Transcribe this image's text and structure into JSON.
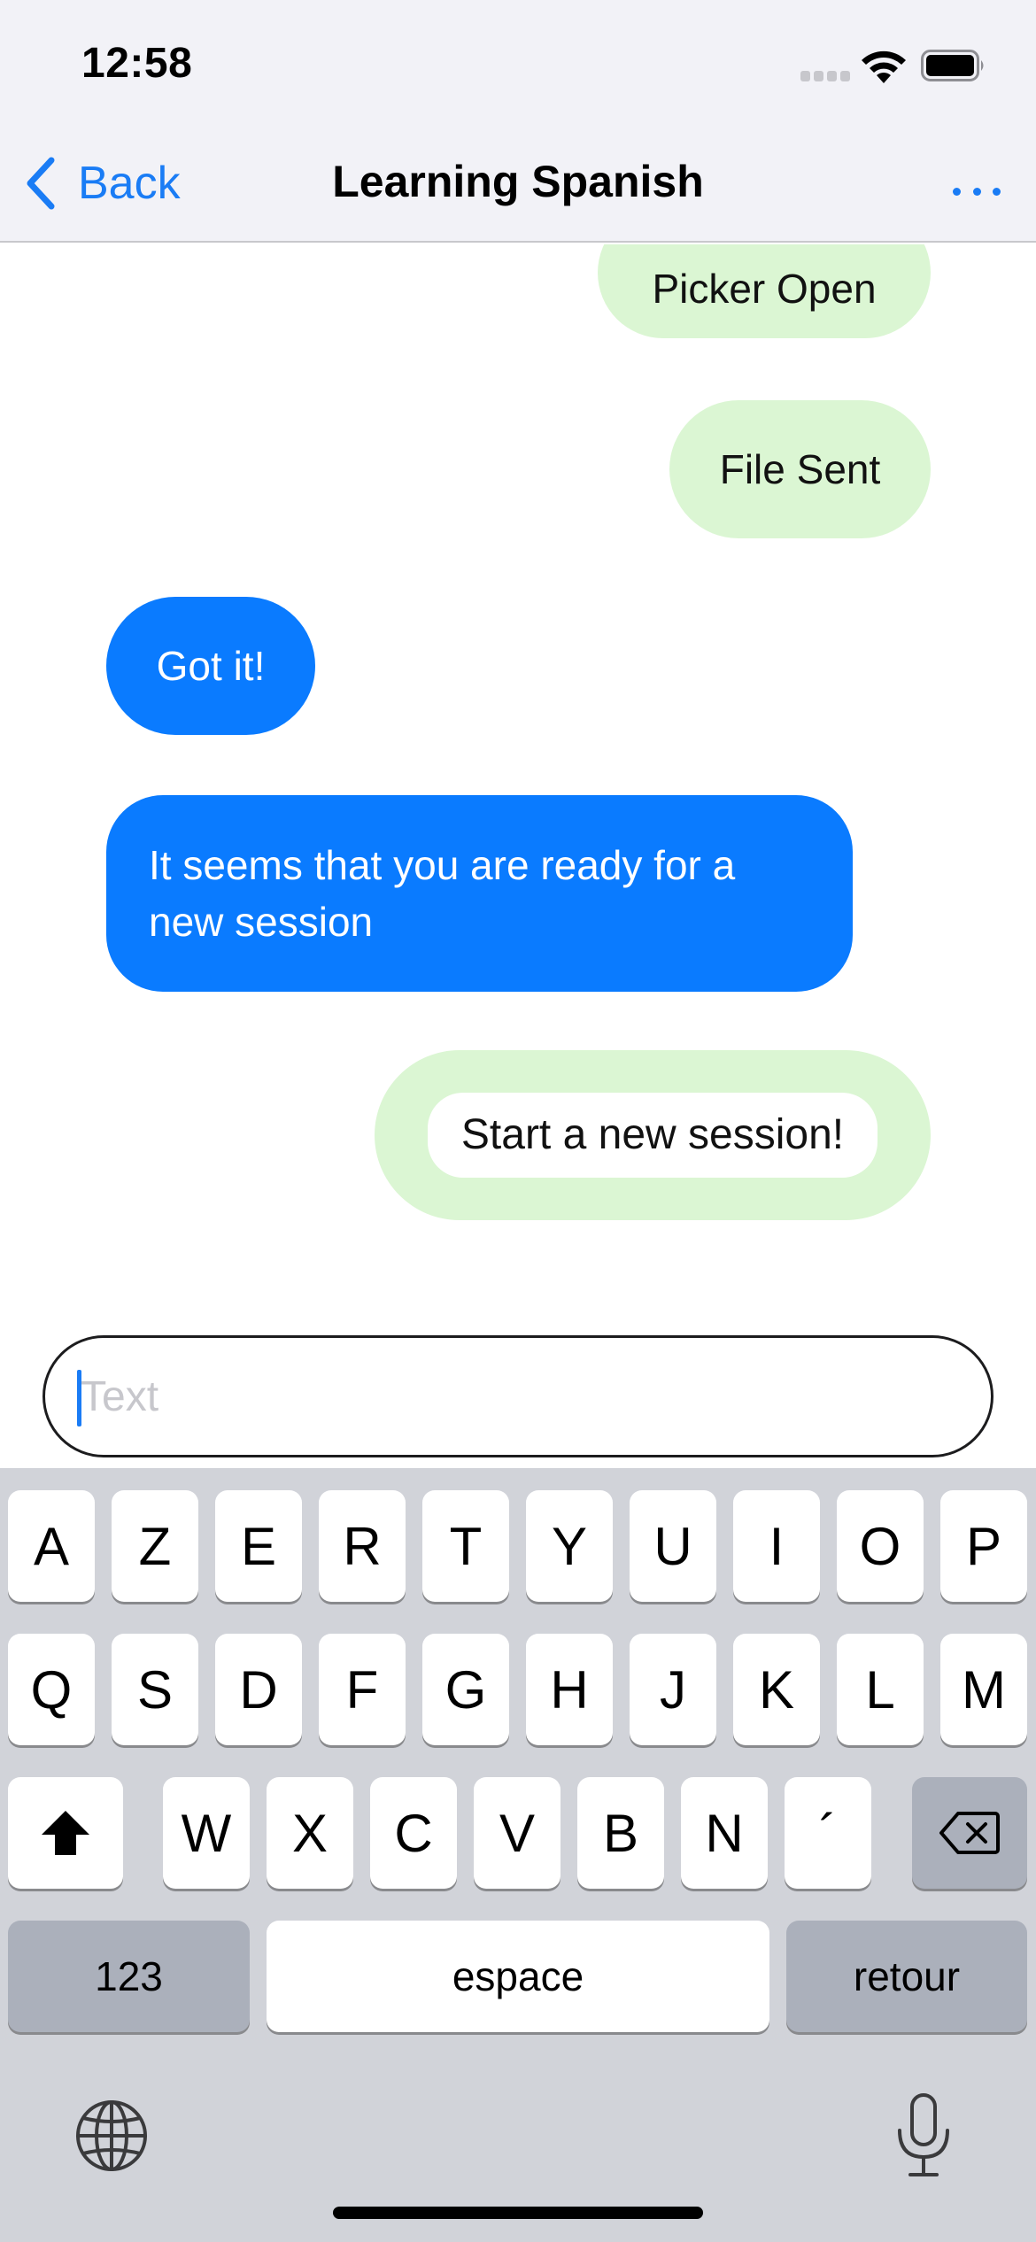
{
  "status_bar": {
    "time": "12:58"
  },
  "nav": {
    "back_label": "Back",
    "title": "Learning Spanish",
    "more_icon": "ellipsis-icon"
  },
  "messages": [
    {
      "side": "outgoing",
      "text": "Picker Open"
    },
    {
      "side": "outgoing",
      "text": "File Sent"
    },
    {
      "side": "incoming",
      "text": "Got it!"
    },
    {
      "side": "incoming",
      "text": "It seems that you are ready for a new session"
    },
    {
      "side": "outgoing",
      "action_label": "Start a new session!"
    }
  ],
  "composer": {
    "placeholder": "Text",
    "value": ""
  },
  "keyboard": {
    "row1": [
      "A",
      "Z",
      "E",
      "R",
      "T",
      "Y",
      "U",
      "I",
      "O",
      "P"
    ],
    "row2": [
      "Q",
      "S",
      "D",
      "F",
      "G",
      "H",
      "J",
      "K",
      "L",
      "M"
    ],
    "row3": [
      "W",
      "X",
      "C",
      "V",
      "B",
      "N",
      "´"
    ],
    "numbers_label": "123",
    "space_label": "espace",
    "return_label": "retour"
  },
  "colors": {
    "accent": "#1a7cf5",
    "incoming_bubble": "#0a7bff",
    "outgoing_bubble": "#dbf6d3",
    "keyboard_bg": "#d1d3d9"
  }
}
